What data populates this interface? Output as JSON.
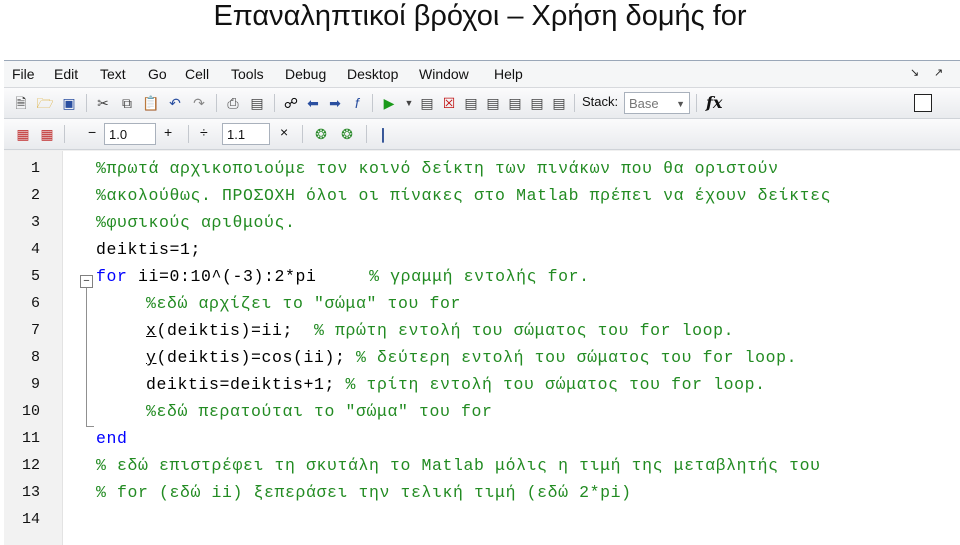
{
  "slide": {
    "title": "Επαναληπτικοί βρόχοι – Χρήση δομής for"
  },
  "menubar": {
    "items": [
      "File",
      "Edit",
      "Text",
      "Go",
      "Cell",
      "Tools",
      "Debug",
      "Desktop",
      "Window",
      "Help"
    ],
    "right_controls": [
      "↘",
      "↗"
    ]
  },
  "toolbar1": {
    "icons": [
      "new-file-icon",
      "open-folder-icon",
      "save-icon",
      "cut-icon",
      "copy-icon",
      "paste-icon",
      "undo-icon",
      "redo-icon",
      "print-icon",
      "print-preview-icon",
      "find-icon",
      "back-icon",
      "forward-icon",
      "function-browser-icon",
      "run-icon",
      "run-dropdown-icon",
      "breakpoint-icon",
      "clear-breakpoint-icon",
      "step-icon",
      "step-in-icon",
      "step-out-icon",
      "continue-icon",
      "exit-debug-icon"
    ],
    "stack_label": "Stack:",
    "stack_value": "Base",
    "fx_label": "fx"
  },
  "toolbar2": {
    "minus_label": "−",
    "field1_value": "1.0",
    "plus_label": "+",
    "divide_label": "÷",
    "field2_value": "1.1",
    "times_label": "×"
  },
  "editor": {
    "line_numbers": [
      "1",
      "2",
      "3",
      "4",
      "5",
      "6",
      "7",
      "8",
      "9",
      "10",
      "11",
      "12",
      "13",
      "14"
    ],
    "lines": [
      {
        "parts": [
          {
            "t": "%πρωτά αρχικοποιούμε τον κοινό δείκτη των πινάκων που θα οριστούν",
            "c": "cmt"
          }
        ],
        "indent": 0
      },
      {
        "parts": [
          {
            "t": "%ακολούθως. ΠΡΟΣΟΧΗ όλοι οι πίνακες στο Matlab πρέπει να έχουν δείκτες",
            "c": "cmt"
          }
        ],
        "indent": 0
      },
      {
        "parts": [
          {
            "t": "%φυσικούς αριθμούς.",
            "c": "cmt"
          }
        ],
        "indent": 0
      },
      {
        "parts": [
          {
            "t": "deiktis=1;",
            "c": ""
          }
        ],
        "indent": 0
      },
      {
        "parts": [
          {
            "t": "for",
            "c": "kw"
          },
          {
            "t": " ii=0:10^(-3):2*pi     ",
            "c": ""
          },
          {
            "t": "% γραμμή εντολής for.",
            "c": "cmt"
          }
        ],
        "indent": 0
      },
      {
        "parts": [
          {
            "t": "%εδώ αρχίζει το \"σώμα\" του for",
            "c": "cmt"
          }
        ],
        "indent": 1
      },
      {
        "parts": [
          {
            "t": "x",
            "c": "ul"
          },
          {
            "t": "(deiktis)=ii;  ",
            "c": ""
          },
          {
            "t": "% πρώτη εντολή του σώματος του for loop.",
            "c": "cmt"
          }
        ],
        "indent": 1
      },
      {
        "parts": [
          {
            "t": "y",
            "c": "ul"
          },
          {
            "t": "(deiktis)=cos(ii); ",
            "c": ""
          },
          {
            "t": "% δεύτερη εντολή του σώματος του for loop.",
            "c": "cmt"
          }
        ],
        "indent": 1
      },
      {
        "parts": [
          {
            "t": "deiktis=deiktis+1; ",
            "c": ""
          },
          {
            "t": "% τρίτη εντολή του σώματος του for loop.",
            "c": "cmt"
          }
        ],
        "indent": 1
      },
      {
        "parts": [
          {
            "t": "%εδώ περατούται το \"σώμα\" του for",
            "c": "cmt"
          }
        ],
        "indent": 1
      },
      {
        "parts": [
          {
            "t": "end",
            "c": "kw"
          }
        ],
        "indent": 0
      },
      {
        "parts": [
          {
            "t": "% εδώ επιστρέφει τη σκυτάλη το Matlab μόλις η τιμή της μεταβλητής του",
            "c": "cmt"
          }
        ],
        "indent": 0
      },
      {
        "parts": [
          {
            "t": "% for (εδώ ii) ξεπεράσει την τελική τιμή (εδώ 2*pi)",
            "c": "cmt"
          }
        ],
        "indent": 0
      },
      {
        "parts": [],
        "indent": 0
      }
    ]
  }
}
